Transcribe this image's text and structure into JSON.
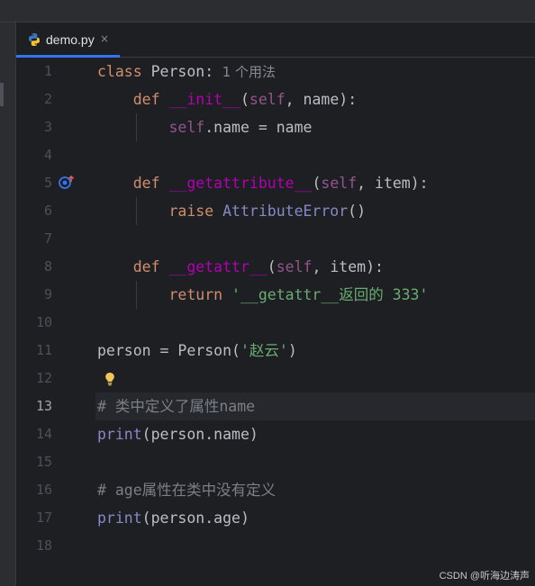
{
  "tab": {
    "filename": "demo.py",
    "close_glyph": "×",
    "icon": "python-file-icon",
    "accent_color": "#3574f0"
  },
  "gutter": {
    "line_numbers": [
      "1",
      "2",
      "3",
      "4",
      "5",
      "6",
      "7",
      "8",
      "9",
      "10",
      "11",
      "12",
      "13",
      "14",
      "15",
      "16",
      "17",
      "18"
    ],
    "current_line": "13",
    "override_icon": "override-method-icon",
    "bulb_icon": "lightbulb-icon"
  },
  "code": {
    "l1": {
      "kw": "class",
      "name": " Person:",
      "hint": "  1 个用法"
    },
    "l2": {
      "indent": "    ",
      "kw": "def",
      "sp": " ",
      "fn": "__init__",
      "open": "(",
      "self": "self",
      "rest": ", name):"
    },
    "l3": {
      "indent": "        ",
      "self": "self",
      "rest": ".name = name"
    },
    "l5": {
      "indent": "    ",
      "kw": "def",
      "sp": " ",
      "fn": "__getattribute__",
      "open": "(",
      "self": "self",
      "rest": ", item):"
    },
    "l6": {
      "indent": "        ",
      "kw": "raise",
      "sp": " ",
      "cls": "AttributeError",
      "rest": "()"
    },
    "l8": {
      "indent": "    ",
      "kw": "def",
      "sp": " ",
      "fn": "__getattr__",
      "open": "(",
      "self": "self",
      "rest": ", item):"
    },
    "l9": {
      "indent": "        ",
      "kw": "return",
      "sp": " ",
      "str": "'__getattr__返回的 333'"
    },
    "l11": {
      "pre": "person = Person(",
      "str": "'赵云'",
      "post": ")"
    },
    "l13": {
      "cmt": "# 类中定义了属性name"
    },
    "l14": {
      "fn": "print",
      "rest": "(person.name)"
    },
    "l16": {
      "cmt": "# age属性在类中没有定义"
    },
    "l17": {
      "fn": "print",
      "rest": "(person.age)"
    }
  },
  "watermark": "CSDN @听海边涛声"
}
